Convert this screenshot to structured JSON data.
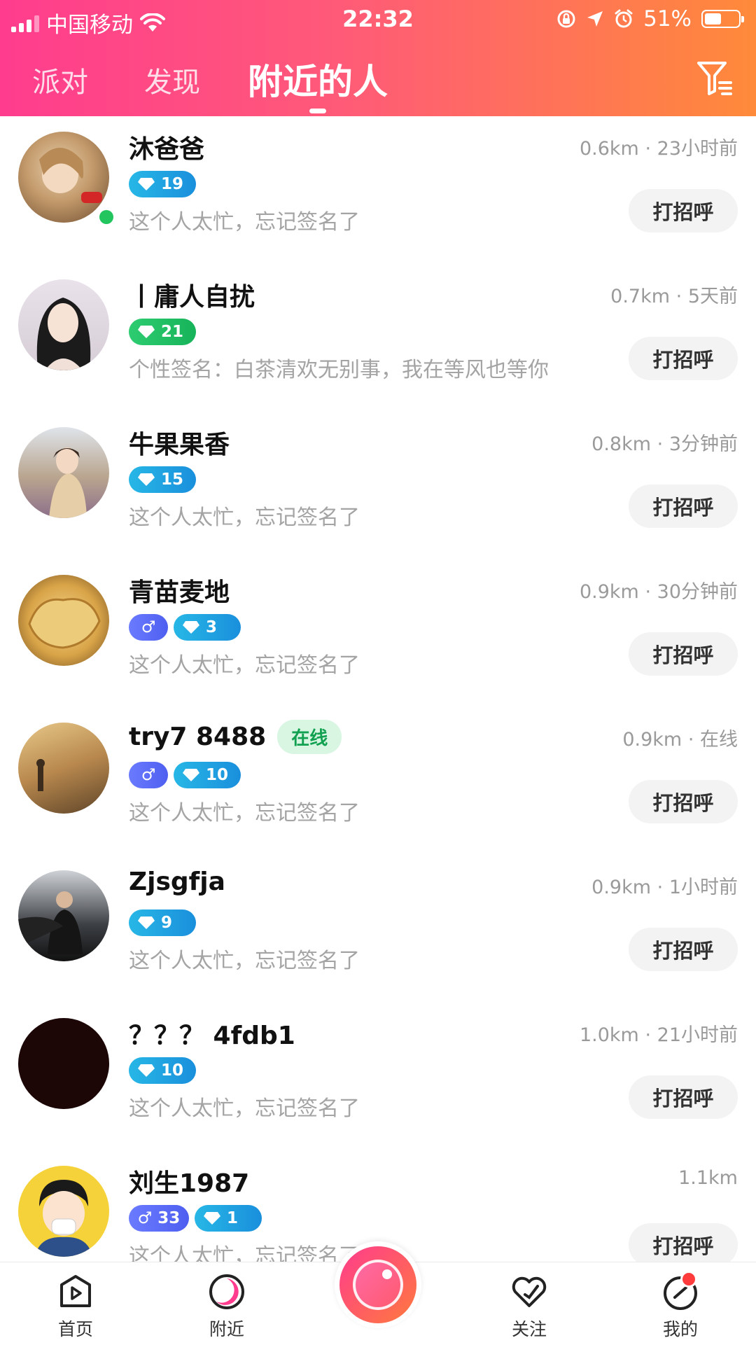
{
  "status_bar": {
    "carrier": "中国移动",
    "time": "22:32",
    "battery_percent": "51%",
    "battery_level": 0.51
  },
  "tabs": [
    {
      "label": "派对",
      "active": false
    },
    {
      "label": "发现",
      "active": false
    },
    {
      "label": "附近的人",
      "active": true
    }
  ],
  "colors": {
    "header_gradient_start": "#ff3c8e",
    "header_gradient_end": "#ff8a3a",
    "diamond_pill": "#1a8fdc",
    "gender_pill": "#4e5ff0",
    "online_green": "#12a150"
  },
  "users": [
    {
      "name": "沐爸爸",
      "distance": "0.6km",
      "sep": "·",
      "time": "23小时前",
      "diamond": "19",
      "diamond_color": "blue",
      "signature": "这个人太忙，忘记签名了",
      "greet": "打招呼",
      "online_badge": true
    },
    {
      "name": "丨庸人自扰",
      "distance": "0.7km",
      "sep": "·",
      "time": "5天前",
      "diamond": "21",
      "diamond_color": "green",
      "signature": "个性签名：白茶清欢无别事，我在等风也等你",
      "greet": "打招呼"
    },
    {
      "name": "牛果果香",
      "distance": "0.8km",
      "sep": "·",
      "time": "3分钟前",
      "diamond": "15",
      "diamond_color": "blue",
      "signature": "这个人太忙，忘记签名了",
      "greet": "打招呼"
    },
    {
      "name": "青苗麦地",
      "distance": "0.9km",
      "sep": "·",
      "time": "30分钟前",
      "gender": "♂",
      "diamond": "3",
      "diamond_color": "blue",
      "signature": "这个人太忙，忘记签名了",
      "greet": "打招呼"
    },
    {
      "name": "try7  8488",
      "online_tag": "在线",
      "distance": "0.9km",
      "sep": "·",
      "time": "在线",
      "gender": "♂",
      "diamond": "10",
      "diamond_color": "blue",
      "signature": "这个人太忙，忘记签名了",
      "greet": "打招呼"
    },
    {
      "name": "Zjsgfja",
      "distance": "0.9km",
      "sep": "·",
      "time": "1小时前",
      "diamond": "9",
      "diamond_color": "blue",
      "signature": "这个人太忙，忘记签名了",
      "greet": "打招呼"
    },
    {
      "name": "？？？ 4fdb1",
      "distance": "1.0km",
      "sep": "·",
      "time": "21小时前",
      "diamond": "10",
      "diamond_color": "blue",
      "signature": "这个人太忙，忘记签名了",
      "greet": "打招呼"
    },
    {
      "name": "刘生1987",
      "distance": "1.1km",
      "gender": "♂",
      "gender_level": "33",
      "diamond": "1",
      "diamond_color": "blue",
      "signature": "这个人太忙，忘记签名了",
      "greet": "打招呼"
    }
  ],
  "bottom_nav": [
    {
      "label": "首页",
      "icon": "play-square-icon"
    },
    {
      "label": "附近",
      "icon": "nearby-circle-icon"
    },
    {
      "label": "",
      "icon": "camera-record-icon"
    },
    {
      "label": "关注",
      "icon": "heart-check-icon"
    },
    {
      "label": "我的",
      "icon": "profile-circle-icon",
      "has_red_dot": true
    }
  ]
}
